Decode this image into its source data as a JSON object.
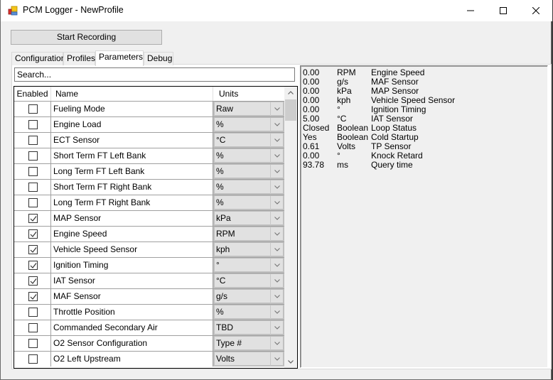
{
  "window": {
    "title": "PCM Logger - NewProfile",
    "controls": {
      "minimize": "minimize",
      "maximize": "maximize",
      "close": "close"
    }
  },
  "toolbar": {
    "start_recording_label": "Start Recording"
  },
  "tabs": [
    {
      "label": "Configuration",
      "active": false
    },
    {
      "label": "Profiles",
      "active": false
    },
    {
      "label": "Parameters",
      "active": true
    },
    {
      "label": "Debug",
      "active": false
    }
  ],
  "search": {
    "value": "Search...",
    "placeholder": "Search..."
  },
  "grid": {
    "columns": {
      "enabled": "Enabled",
      "name": "Name",
      "units": "Units"
    },
    "rows": [
      {
        "enabled": false,
        "name": "Fueling Mode",
        "units": "Raw"
      },
      {
        "enabled": false,
        "name": "Engine Load",
        "units": "%"
      },
      {
        "enabled": false,
        "name": "ECT Sensor",
        "units": "°C"
      },
      {
        "enabled": false,
        "name": "Short Term FT Left Bank",
        "units": "%"
      },
      {
        "enabled": false,
        "name": "Long Term FT Left Bank",
        "units": "%"
      },
      {
        "enabled": false,
        "name": "Short Term FT Right Bank",
        "units": "%"
      },
      {
        "enabled": false,
        "name": "Long Term FT Right Bank",
        "units": "%"
      },
      {
        "enabled": true,
        "name": "MAP Sensor",
        "units": "kPa"
      },
      {
        "enabled": true,
        "name": "Engine Speed",
        "units": "RPM"
      },
      {
        "enabled": true,
        "name": "Vehicle Speed Sensor",
        "units": "kph"
      },
      {
        "enabled": true,
        "name": "Ignition Timing",
        "units": "°"
      },
      {
        "enabled": true,
        "name": "IAT Sensor",
        "units": "°C"
      },
      {
        "enabled": true,
        "name": "MAF Sensor",
        "units": "g/s"
      },
      {
        "enabled": false,
        "name": "Throttle Position",
        "units": "%"
      },
      {
        "enabled": false,
        "name": "Commanded Secondary Air",
        "units": "TBD"
      },
      {
        "enabled": false,
        "name": "O2 Sensor Configuration",
        "units": "Type #"
      },
      {
        "enabled": false,
        "name": "O2 Left Upstream",
        "units": "Volts"
      }
    ]
  },
  "monitor": {
    "rows": [
      {
        "value": "0.00",
        "unit": "RPM",
        "name": "Engine Speed"
      },
      {
        "value": "0.00",
        "unit": "g/s",
        "name": "MAF Sensor"
      },
      {
        "value": "0.00",
        "unit": "kPa",
        "name": "MAP Sensor"
      },
      {
        "value": "0.00",
        "unit": "kph",
        "name": "Vehicle Speed Sensor"
      },
      {
        "value": "0.00",
        "unit": "°",
        "name": "Ignition Timing"
      },
      {
        "value": "5.00",
        "unit": "°C",
        "name": "IAT Sensor"
      },
      {
        "value": "Closed",
        "unit": "Boolean",
        "name": "Loop Status"
      },
      {
        "value": "Yes",
        "unit": "Boolean",
        "name": "Cold Startup"
      },
      {
        "value": "0.61",
        "unit": "Volts",
        "name": "TP Sensor"
      },
      {
        "value": "0.00",
        "unit": "°",
        "name": "Knock Retard"
      },
      {
        "value": "93.78",
        "unit": "ms",
        "name": "Query time"
      }
    ]
  }
}
